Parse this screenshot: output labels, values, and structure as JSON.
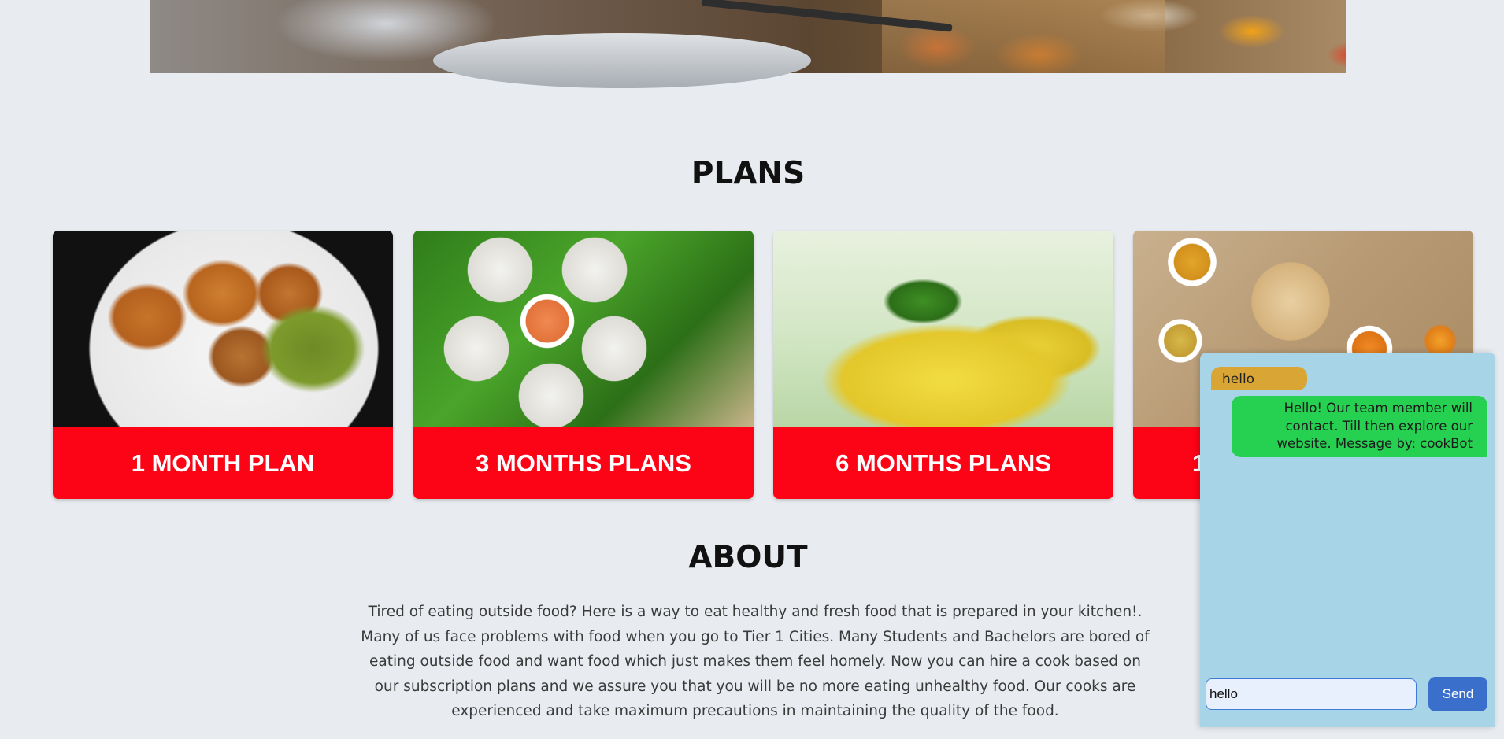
{
  "hero": {
    "image": "cooking-hero-image"
  },
  "plans": {
    "title": "PLANS",
    "cards": [
      {
        "label": "1 MONTH PLAN",
        "image": "samosa-photo"
      },
      {
        "label": "3 MONTHS PLANS",
        "image": "idli-photo"
      },
      {
        "label": "6 MONTHS PLANS",
        "image": "dhokla-photo"
      },
      {
        "label": "1",
        "image": "thali-photo"
      }
    ]
  },
  "about": {
    "title": "ABOUT",
    "text": "Tired of eating outside food? Here is a way to eat healthy and fresh food that is prepared in your kitchen!. Many of us face problems with food when you go to Tier 1 Cities. Many Students and Bachelors are bored of eating outside food and want food which just makes them feel homely. Now you can hire a cook based on our subscription plans and we assure you that you will be no more eating unhealthy food. Our cooks are experienced and take maximum precautions in maintaining the quality of the food."
  },
  "chat": {
    "messages": [
      {
        "from": "user",
        "text": "hello"
      },
      {
        "from": "bot",
        "text": "Hello! Our team member will contact. Till then explore our website. Message by: cookBot"
      }
    ],
    "input_value": "hello",
    "send_label": "Send",
    "colors": {
      "user_bubble": "#d9a636",
      "bot_bubble": "#26d152",
      "panel": "#a8d4e8",
      "send": "#3a70cc"
    }
  },
  "colors": {
    "card_label": "#fc0316",
    "page_bg": "#e8ecf0"
  }
}
